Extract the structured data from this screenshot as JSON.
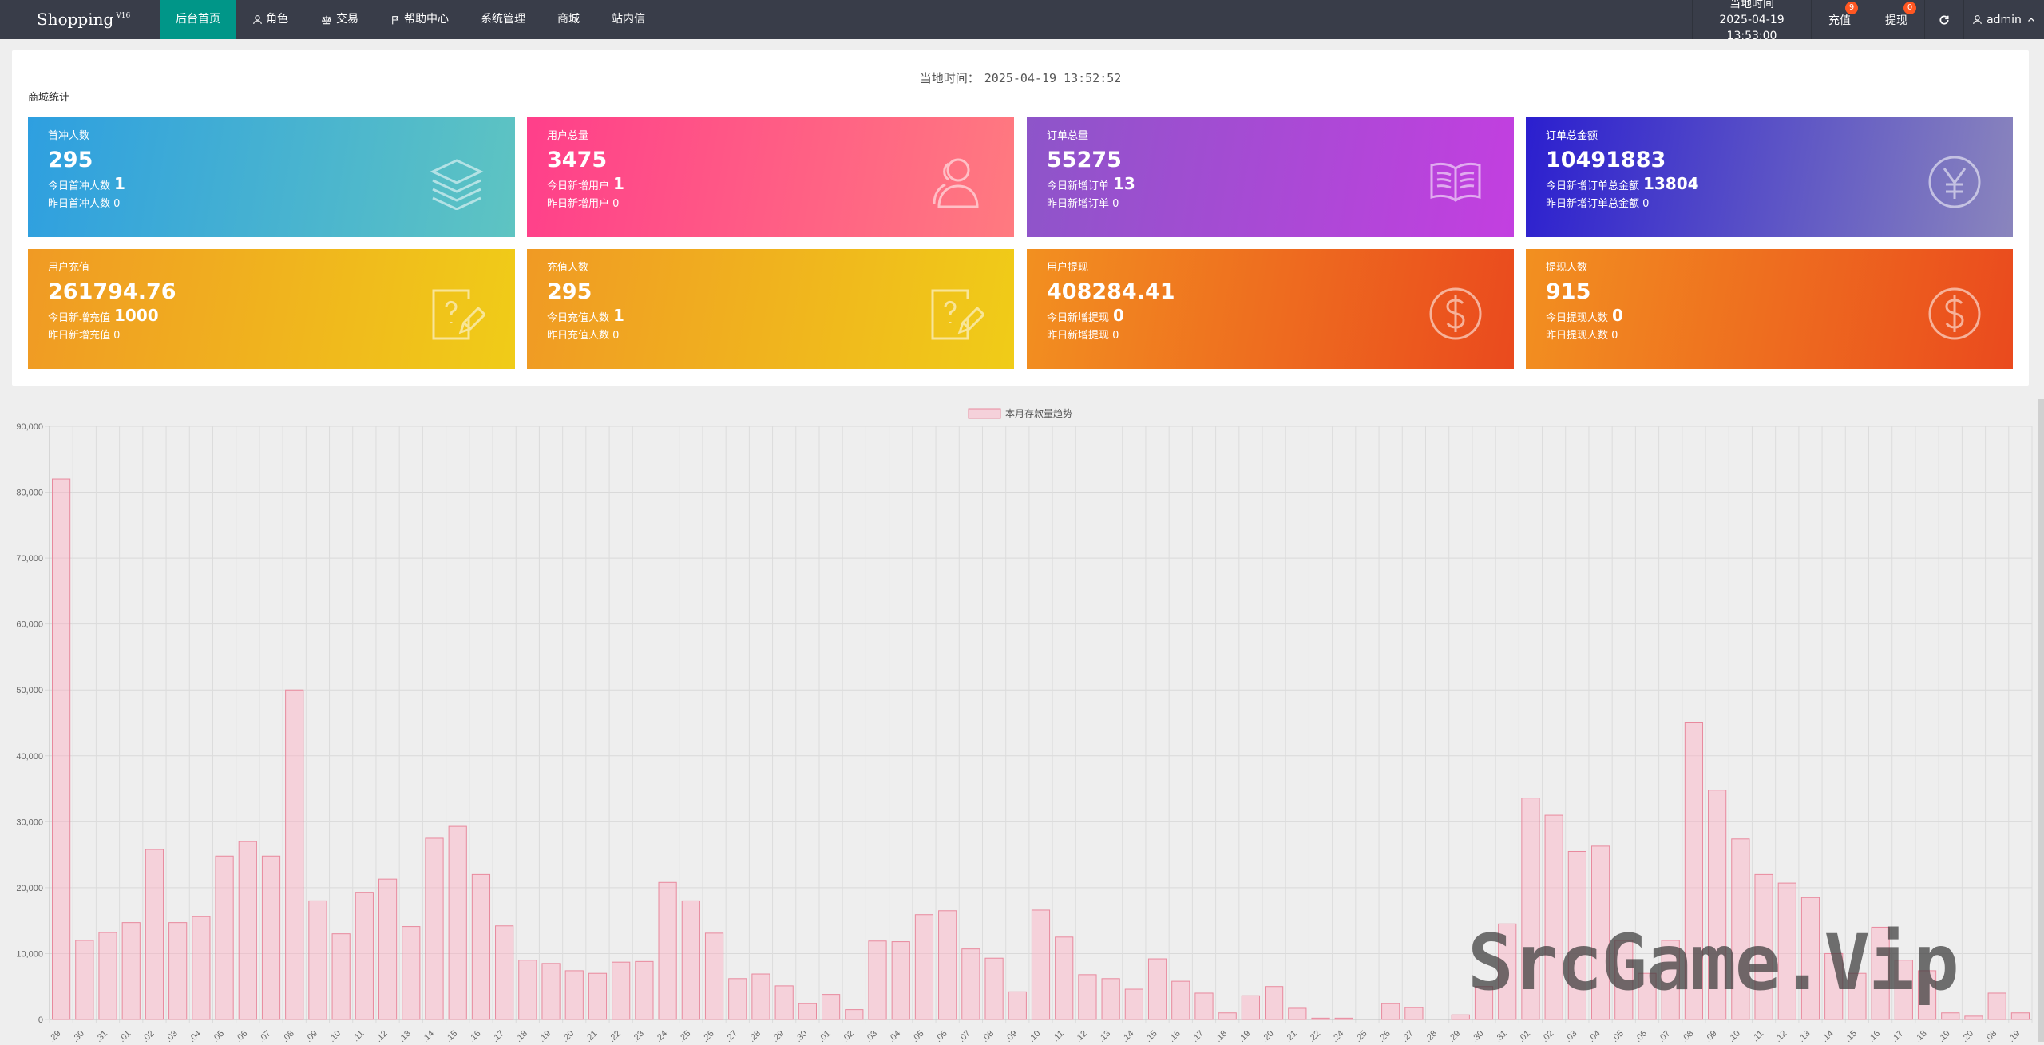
{
  "header": {
    "brand": "Shopping",
    "brand_sup": "V16",
    "nav": [
      {
        "label": "后台首页",
        "icon": "none",
        "active": true
      },
      {
        "label": "角色",
        "icon": "user-icon"
      },
      {
        "label": "交易",
        "icon": "scale-icon"
      },
      {
        "label": "帮助中心",
        "icon": "flag-icon"
      },
      {
        "label": "系统管理",
        "icon": "none"
      },
      {
        "label": "商城",
        "icon": "none"
      },
      {
        "label": "站内信",
        "icon": "none"
      }
    ],
    "clock_label": "当地时间",
    "clock_value": "2025-04-19 13:53:00",
    "recharge_label": "充值",
    "recharge_badge": "9",
    "withdraw_label": "提现",
    "withdraw_badge": "0",
    "refresh_icon": "refresh-icon",
    "user_label": "admin"
  },
  "panel": {
    "local_time_label": "当地时间：",
    "local_time_value": "2025-04-19 13:52:52",
    "section_title": "商城统计",
    "cards": [
      {
        "title": "首冲人数",
        "value": "295",
        "line1": "今日首冲人数",
        "line1_val": "1",
        "line2": "昨日首冲人数",
        "line2_val": "0",
        "icon": "layers-icon",
        "gradient": [
          "#2e9fe0",
          "#5ec4c2"
        ]
      },
      {
        "title": "用户总量",
        "value": "3475",
        "line1": "今日新增用户",
        "line1_val": "1",
        "line2": "昨日新增用户",
        "line2_val": "0",
        "icon": "users-icon",
        "gradient": [
          "#ff3f8a",
          "#ff7a80"
        ]
      },
      {
        "title": "订单总量",
        "value": "55275",
        "line1": "今日新增订单",
        "line1_val": "13",
        "line2": "昨日新增订单",
        "line2_val": "0",
        "icon": "book-icon",
        "gradient": [
          "#8d55c9",
          "#c33fe0"
        ]
      },
      {
        "title": "订单总金额",
        "value": "10491883",
        "line1": "今日新增订单总金额",
        "line1_val": "13804",
        "line2": "昨日新增订单总金额",
        "line2_val": "0",
        "icon": "yen-icon",
        "gradient": [
          "#2b1fcf",
          "#8a85bd"
        ]
      },
      {
        "title": "用户充值",
        "value": "261794.76",
        "line1": "今日新增充值",
        "line1_val": "1000",
        "line2": "昨日新增充值",
        "line2_val": "0",
        "icon": "help-doc-icon",
        "gradient": [
          "#f09a24",
          "#f0cc18"
        ]
      },
      {
        "title": "充值人数",
        "value": "295",
        "line1": "今日充值人数",
        "line1_val": "1",
        "line2": "昨日充值人数",
        "line2_val": "0",
        "icon": "help-doc-icon",
        "gradient": [
          "#f09a24",
          "#f0cc18"
        ]
      },
      {
        "title": "用户提现",
        "value": "408284.41",
        "line1": "今日新增提现",
        "line1_val": "0",
        "line2": "昨日新增提现",
        "line2_val": "0",
        "icon": "dollar-icon",
        "gradient": [
          "#f29020",
          "#ea4a1e"
        ]
      },
      {
        "title": "提现人数",
        "value": "915",
        "line1": "今日提现人数",
        "line1_val": "0",
        "line2": "昨日提现人数",
        "line2_val": "0",
        "icon": "dollar-icon",
        "gradient": [
          "#f29020",
          "#ea4a1e"
        ]
      }
    ]
  },
  "chart_data": {
    "type": "bar",
    "legend": "本月存款量趋势",
    "legend_position": "top-center",
    "ylim": [
      0,
      90000
    ],
    "yticks": [
      0,
      10000,
      20000,
      30000,
      40000,
      50000,
      60000,
      70000,
      80000,
      90000
    ],
    "ytick_labels": [
      "0",
      "10,000",
      "20,000",
      "30,000",
      "40,000",
      "50,000",
      "60,000",
      "70,000",
      "80,000",
      "90,000"
    ],
    "grid": true,
    "categories": [
      "..29",
      "..30",
      "..31",
      "..01",
      "..02",
      "..03",
      "..04",
      "..05",
      "..06",
      "..07",
      "..08",
      "..09",
      "..10",
      "..11",
      "..12",
      "..13",
      "..14",
      "..15",
      "..16",
      "..17",
      "..18",
      "..19",
      "..20",
      "..21",
      "..22",
      "..23",
      "..24",
      "..25",
      "..26",
      "..27",
      "..28",
      "..29",
      "..30",
      "..01",
      "..02",
      "..03",
      "..04",
      "..05",
      "..06",
      "..07",
      "..08",
      "..09",
      "..10",
      "..11",
      "..12",
      "..13",
      "..14",
      "..15",
      "..16",
      "..17",
      "..18",
      "..19",
      "..20",
      "..21",
      "..22",
      "..24",
      "..25",
      "..26",
      "..27",
      "..28",
      "..29",
      "..30",
      "..31",
      "..01",
      "..02",
      "..03",
      "..04",
      "..05",
      "..06",
      "..07",
      "..08",
      "..09",
      "..10",
      "..11",
      "..12",
      "..13",
      "..14",
      "..15",
      "..16",
      "..17",
      "..18",
      "..19",
      "..20",
      "..08",
      "..19"
    ],
    "values": [
      82000,
      12000,
      13200,
      14700,
      25800,
      14700,
      15600,
      24800,
      27000,
      24800,
      50000,
      18000,
      13000,
      19300,
      21300,
      14100,
      27500,
      29300,
      22000,
      14200,
      9000,
      8500,
      7400,
      7000,
      8700,
      8800,
      20800,
      18000,
      13100,
      6200,
      6900,
      5100,
      2400,
      3800,
      1500,
      11900,
      11800,
      15900,
      16500,
      10700,
      9300,
      4200,
      16600,
      12500,
      6800,
      6200,
      4600,
      9200,
      5800,
      4000,
      1000,
      3600,
      5000,
      1700,
      200,
      200,
      0,
      2400,
      1800,
      0,
      700,
      5000,
      14500,
      33600,
      31000,
      25500,
      26300,
      12000,
      7000,
      12000,
      45000,
      34800,
      27400,
      22000,
      20700,
      18500,
      10000,
      7000,
      14000,
      9000,
      7400,
      1000,
      500,
      4000,
      1000
    ]
  },
  "watermark": "SrcGame.Vip"
}
